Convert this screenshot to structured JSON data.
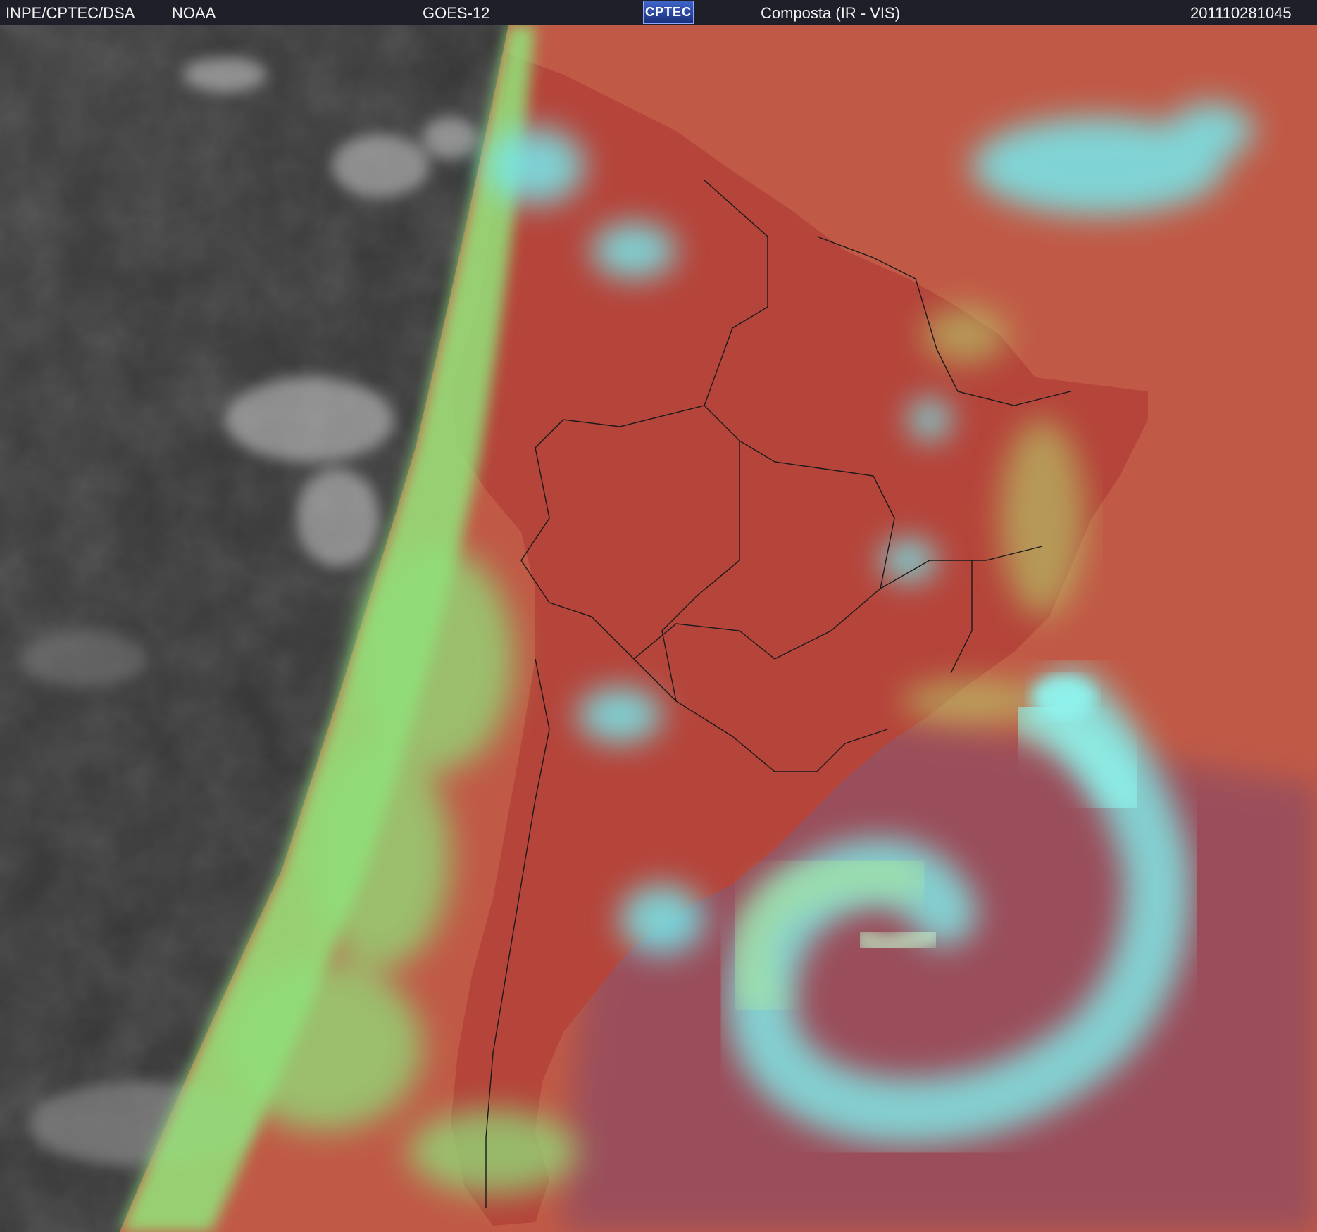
{
  "header": {
    "agency": "INPE/CPTEC/DSA",
    "noaa": "NOAA",
    "satellite": "GOES-12",
    "logo": "CPTEC",
    "product": "Composta (IR - VIS)",
    "timestamp": "201110281045"
  },
  "colors": {
    "header_bg": "#1f1f29",
    "night_gray": "#3a3a3a",
    "land_red": "#b8473c",
    "ocean_red": "#c45a45",
    "high_cloud_cyan": "#7cf2f0",
    "low_cloud_green": "#8fe07a",
    "ocean_mauve": "#8a4a62"
  },
  "icons": [
    "cptec-logo-icon"
  ]
}
